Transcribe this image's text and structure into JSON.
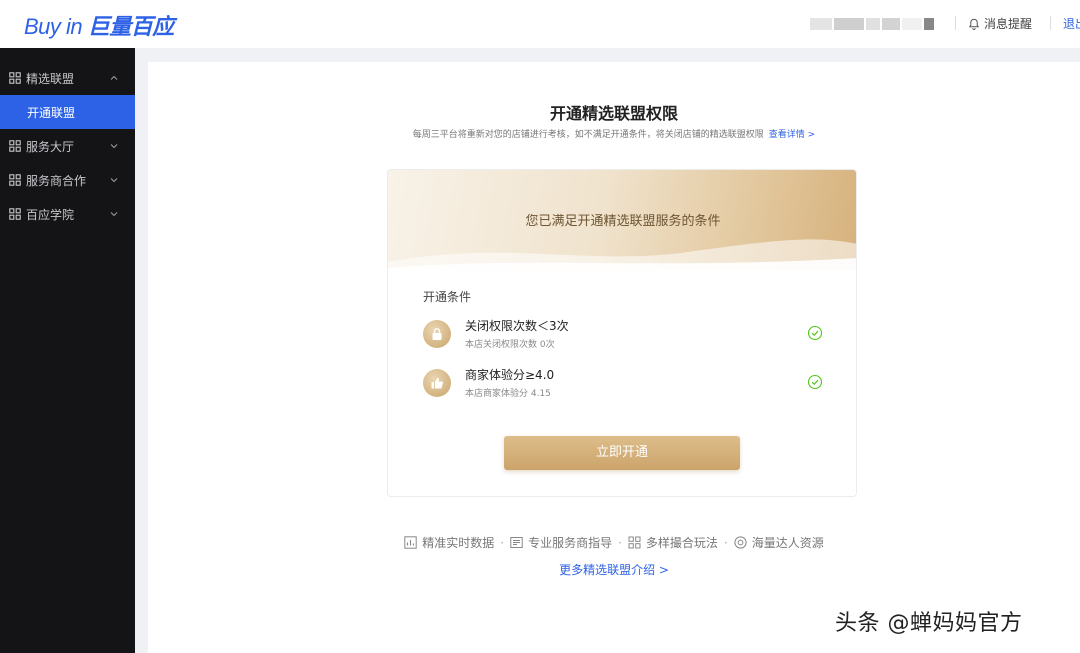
{
  "header": {
    "logo_latin": "Buy in",
    "logo_cn": "巨量百应",
    "notification_label": "消息提醒",
    "logout_label": "退出"
  },
  "sidebar": {
    "items": [
      {
        "label": "精选联盟",
        "icon": "grid-icon",
        "expanded": true
      },
      {
        "label": "开通联盟",
        "sub": true,
        "active": true
      },
      {
        "label": "服务大厅",
        "icon": "grid-icon"
      },
      {
        "label": "服务商合作",
        "icon": "grid-icon"
      },
      {
        "label": "百应学院",
        "icon": "grid-icon"
      }
    ]
  },
  "main": {
    "title": "开通精选联盟权限",
    "subtitle": "每周三平台将重新对您的店铺进行考核，如不满足开通条件，将关闭店铺的精选联盟权限",
    "detail_link": "查看详情 >",
    "banner_text": "您已满足开通精选联盟服务的条件",
    "conditions_label": "开通条件",
    "conditions": [
      {
        "title": "关闭权限次数＜3次",
        "sub": "本店关闭权限次数 0次",
        "icon": "lock-icon",
        "met": true
      },
      {
        "title": "商家体验分≥4.0",
        "sub": "本店商家体验分 4.15",
        "icon": "thumbs-up-icon",
        "met": true
      }
    ],
    "open_button": "立即开通",
    "features": [
      {
        "label": "精准实时数据",
        "icon": "bar-chart-icon"
      },
      {
        "label": "专业服务商指导",
        "icon": "list-icon"
      },
      {
        "label": "多样撮合玩法",
        "icon": "grid-icon"
      },
      {
        "label": "海量达人资源",
        "icon": "target-icon"
      }
    ],
    "separator": "·",
    "more_link": "更多精选联盟介绍 >"
  },
  "watermark": "头条 @蝉妈妈官方",
  "colors": {
    "brand_blue": "#2e62e6",
    "sidebar_bg": "#141417",
    "gold": "#cca46b",
    "check_green": "#52c41a"
  }
}
